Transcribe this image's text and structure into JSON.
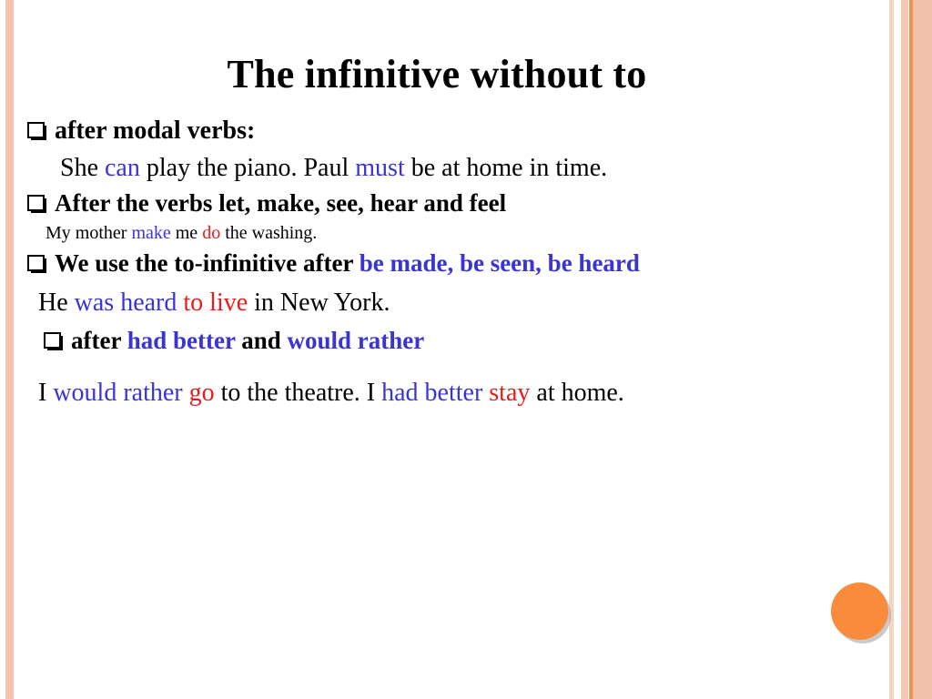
{
  "slide": {
    "title": "The infinitive without to",
    "colors": {
      "blue": "#3a33d6",
      "red": "#ea1b1b",
      "black": "#000000",
      "accent_orange": "#f98b3c",
      "border_peach": "#f6c4ad"
    },
    "bullet_glyph": "❑",
    "sections": [
      {
        "heading": {
          "parts": [
            {
              "text": "after modal verbs:",
              "color": "black"
            }
          ]
        },
        "example": {
          "parts": [
            {
              "text": "She ",
              "color": "black"
            },
            {
              "text": "can",
              "color": "blue"
            },
            {
              "text": " play the piano. Paul ",
              "color": "black"
            },
            {
              "text": "must",
              "color": "blue"
            },
            {
              "text": " be at home in time.",
              "color": "black"
            }
          ]
        }
      },
      {
        "heading": {
          "parts": [
            {
              "text": "After the verbs let, make, see, hear and feel",
              "color": "black"
            }
          ]
        },
        "example": {
          "parts": [
            {
              "text": "My mother ",
              "color": "black"
            },
            {
              "text": "make",
              "color": "blue"
            },
            {
              "text": " me ",
              "color": "black"
            },
            {
              "text": "do",
              "color": "red"
            },
            {
              "text": " the washing.",
              "color": "black"
            }
          ]
        }
      },
      {
        "heading": {
          "parts": [
            {
              "text": "We use the to-infinitive after ",
              "color": "black"
            },
            {
              "text": "be made, be seen, be heard",
              "color": "blue"
            }
          ]
        },
        "example": {
          "parts": [
            {
              "text": "He ",
              "color": "black"
            },
            {
              "text": "was heard ",
              "color": "blue"
            },
            {
              "text": "to live",
              "color": "red"
            },
            {
              "text": " in New York.",
              "color": "black"
            }
          ]
        }
      },
      {
        "heading": {
          "parts": [
            {
              "text": "after ",
              "color": "black"
            },
            {
              "text": "had better",
              "color": "blue"
            },
            {
              "text": " and ",
              "color": "black"
            },
            {
              "text": "would rather",
              "color": "blue"
            }
          ]
        },
        "example": {
          "parts": [
            {
              "text": "I ",
              "color": "black"
            },
            {
              "text": "would rather ",
              "color": "blue"
            },
            {
              "text": "go",
              "color": "red"
            },
            {
              "text": " to the theatre. I ",
              "color": "black"
            },
            {
              "text": "had better ",
              "color": "blue"
            },
            {
              "text": "stay",
              "color": "red"
            },
            {
              "text": " at home.",
              "color": "black"
            }
          ]
        }
      }
    ]
  },
  "text": {
    "s0_heading": "after modal verbs:",
    "s0_ex_a": "She ",
    "s0_ex_can": "can",
    "s0_ex_b": " play the piano. Paul ",
    "s0_ex_must": "must",
    "s0_ex_c": " be at home in time.",
    "s1_heading": "After the verbs let, make, see, hear and feel",
    "s1_ex_a": "My mother ",
    "s1_ex_make": "make",
    "s1_ex_b": " me ",
    "s1_ex_do": "do",
    "s1_ex_c": " the washing.",
    "s2_heading_black": "We use the to-infinitive after ",
    "s2_heading_blue": "be made, be seen, be heard",
    "s2_ex_a": "He ",
    "s2_ex_blue": "was heard ",
    "s2_ex_red": "to live",
    "s2_ex_b": " in New York.",
    "s3_heading_a": "after ",
    "s3_heading_blue1": "had better",
    "s3_heading_b": " and ",
    "s3_heading_blue2": "would rather",
    "s3_ex_a": "I ",
    "s3_ex_blue1": "would rather ",
    "s3_ex_red1": "go",
    "s3_ex_b": " to the theatre. I ",
    "s3_ex_blue2": "had better ",
    "s3_ex_red2": "stay",
    "s3_ex_c": " at home."
  }
}
